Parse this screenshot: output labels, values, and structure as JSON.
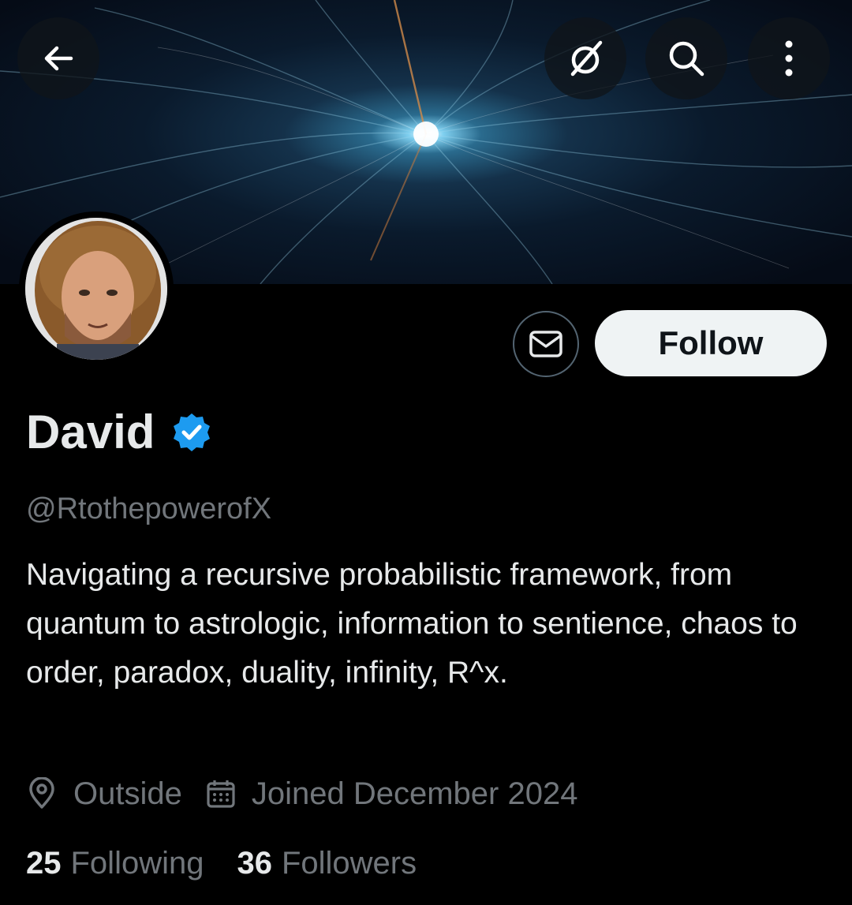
{
  "header": {
    "back_icon": "arrow-left-icon",
    "grok_icon": "slashed-circle-icon",
    "search_icon": "search-icon",
    "more_icon": "more-vertical-icon"
  },
  "banner": {
    "description_colors": [
      "#050b16",
      "#14314a",
      "#7fd0f0",
      "#ffffff",
      "#c87a3c"
    ]
  },
  "profile": {
    "display_name": "David",
    "verified": true,
    "handle": "@RtothepowerofX",
    "bio": "Navigating a recursive probabilistic framework, from quantum to astrologic, information to sentience, chaos to order, paradox, duality, infinity, R^x.",
    "location": "Outside",
    "joined": "Joined December 2024",
    "following_count": "25",
    "following_label": "Following",
    "followers_count": "36",
    "followers_label": "Followers"
  },
  "actions": {
    "message_icon": "envelope-icon",
    "follow_label": "Follow"
  },
  "colors": {
    "background": "#000000",
    "text_primary": "#e7e9ea",
    "text_secondary": "#71767b",
    "verified_blue": "#1d9bf0",
    "follow_button_bg": "#eff3f4"
  }
}
